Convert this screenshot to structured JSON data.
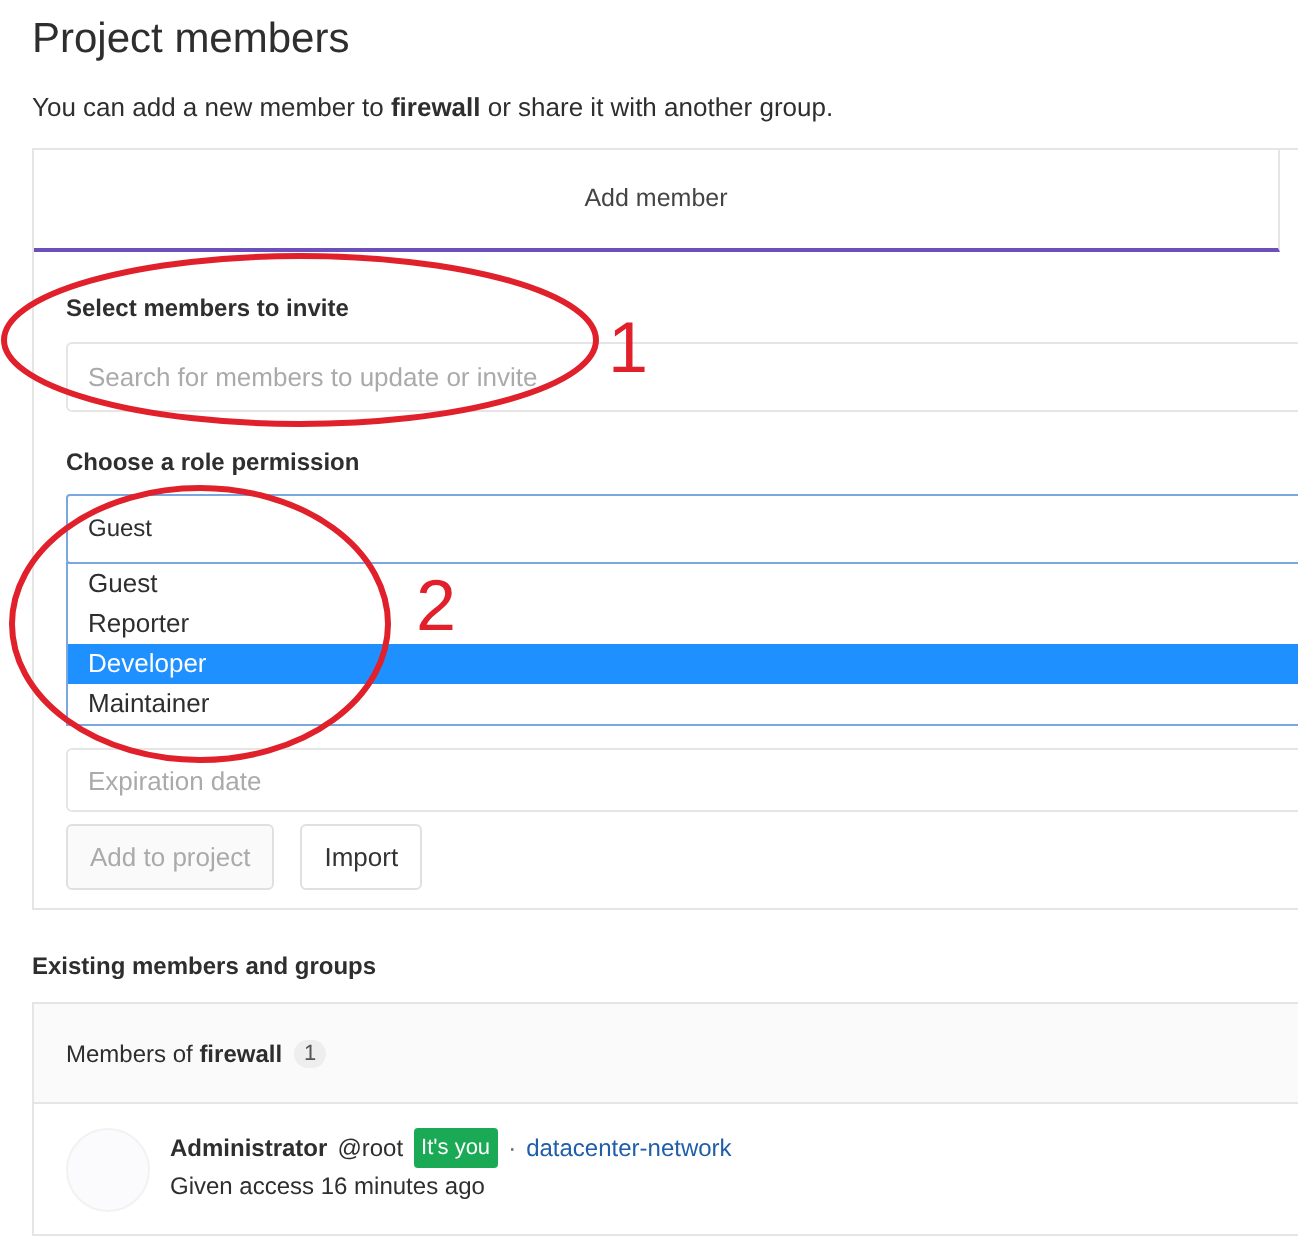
{
  "title": "Project members",
  "subtitle": "You can add a new member to **firewall** or share it with another group.",
  "tabs": [
    {
      "label": "Add member",
      "selected": true
    }
  ],
  "form": {
    "members_label": "Select members to invite",
    "search": {
      "placeholder": "Search for members to update or invite"
    },
    "role_label": "Choose a role permission",
    "role_value": "Guest",
    "role_options": [
      {
        "label": "Guest",
        "selected": false
      },
      {
        "label": "Reporter",
        "selected": false
      },
      {
        "label": "Developer",
        "selected": true
      },
      {
        "label": "Maintainer",
        "selected": false
      }
    ],
    "expiration": {
      "placeholder": "Expiration date"
    },
    "buttons": [
      {
        "label": "Add to project",
        "disabled": true
      },
      {
        "label": "Import",
        "disabled": false
      }
    ]
  },
  "existing": {
    "heading": "Existing members and groups",
    "panel_title": "Members of **firewall**",
    "count": "1",
    "members": [
      {
        "name": "Administrator",
        "username": "@root",
        "badge": "It's you",
        "separator": "·",
        "group": "datacenter-network",
        "access": "Given access 16 minutes ago"
      }
    ]
  },
  "annotations": [
    {
      "label": "1"
    },
    {
      "label": "2"
    }
  ]
}
